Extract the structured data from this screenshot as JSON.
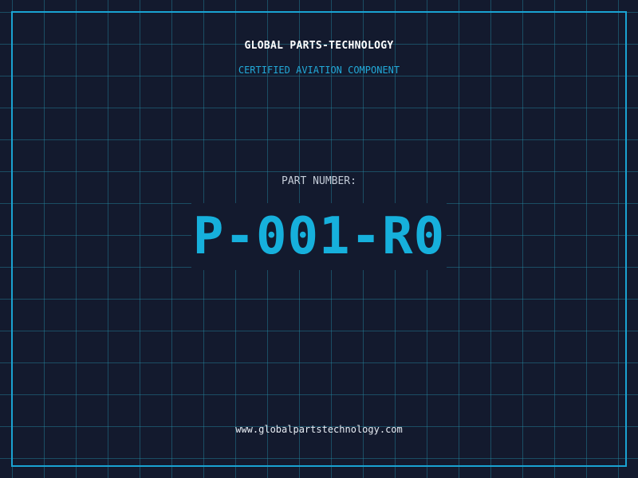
{
  "header": {
    "company_name": "GLOBAL PARTS-TECHNOLOGY",
    "tagline": "CERTIFIED AVIATION COMPONENT"
  },
  "part": {
    "label": "PART NUMBER:",
    "number": "P-001-R0"
  },
  "footer": {
    "website": "www.globalpartstechnology.com"
  },
  "colors": {
    "background": "#131a2e",
    "grid": "#268ca5",
    "frame": "#1aa3d2",
    "accent": "#16b0dc",
    "title": "#ffffff"
  }
}
